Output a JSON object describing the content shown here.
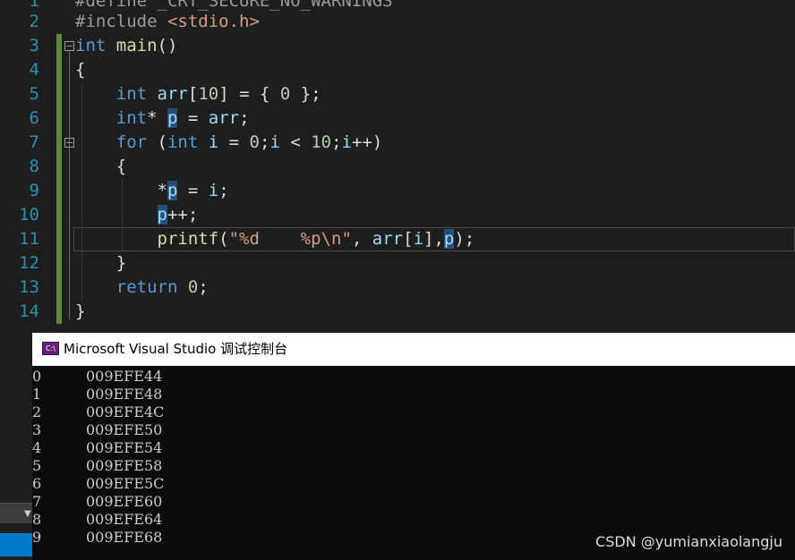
{
  "editor": {
    "line_numbers": [
      "1",
      "2",
      "3",
      "4",
      "5",
      "6",
      "7",
      "8",
      "9",
      "10",
      "11",
      "12",
      "13",
      "14"
    ],
    "line1_text": "#define _CRT_SECURE_NO_WARNINGS",
    "line2_directive": "#include",
    "line2_header": "<stdio.h>",
    "kw_int": "int",
    "fn_main": "main",
    "var_arr": "arr",
    "var_p": "p",
    "var_i": "i",
    "kw_for": "for",
    "fn_printf": "printf",
    "format_string": "\"%d    %p\\n\"",
    "kw_return": "return",
    "num_10": "10",
    "num_0": "0"
  },
  "console": {
    "title": "Microsoft Visual Studio 调试控制台",
    "icon_label": "C:\\",
    "rows": [
      {
        "index": "0",
        "address": "009EFE44"
      },
      {
        "index": "1",
        "address": "009EFE48"
      },
      {
        "index": "2",
        "address": "009EFE4C"
      },
      {
        "index": "3",
        "address": "009EFE50"
      },
      {
        "index": "4",
        "address": "009EFE54"
      },
      {
        "index": "5",
        "address": "009EFE58"
      },
      {
        "index": "6",
        "address": "009EFE5C"
      },
      {
        "index": "7",
        "address": "009EFE60"
      },
      {
        "index": "8",
        "address": "009EFE64"
      },
      {
        "index": "9",
        "address": "009EFE68"
      }
    ]
  },
  "watermark": "CSDN @yumianxiaolangju",
  "colors": {
    "keyword": "#569cd6",
    "string": "#d69d85",
    "function": "#dcdcaa",
    "variable": "#9cdcfe",
    "number": "#b5cea8",
    "line_number": "#2b91af",
    "selection": "#264f78"
  }
}
